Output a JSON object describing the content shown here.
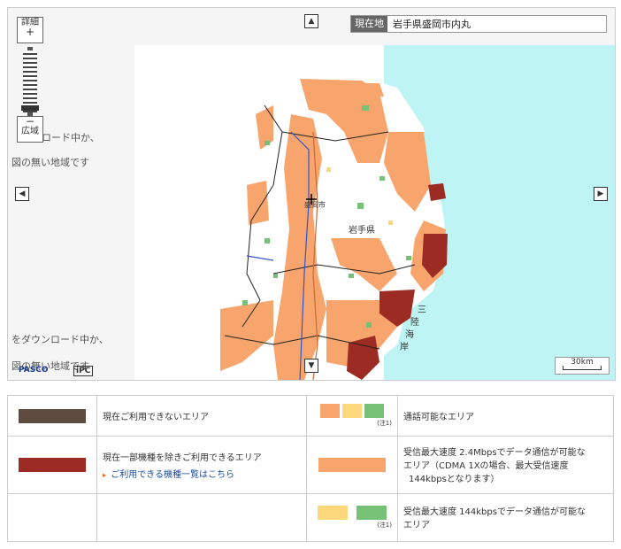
{
  "map": {
    "location_label": "現在地",
    "location_value": "岩手県盛岡市内丸",
    "zoom_in_label": "詳細",
    "zoom_out_label": "広域",
    "plus": "+",
    "minus": "−",
    "nodata_line1": "ロード中か、",
    "nodata_line2": "図の無い地域です",
    "nodata_line3": "をダウンロード中か、",
    "nodata_line4": "図の無い地域です",
    "city_label": "盛岡市",
    "prefecture_label": "岩手県",
    "coast_label_chars": [
      "三",
      "陸",
      "海",
      "岸"
    ],
    "scale_label": "30km",
    "logo_pasco": "PASCO",
    "logo_ipc": "iPC",
    "pan_up_icon": "triangle-up",
    "pan_down_icon": "triangle-down",
    "pan_left_icon": "triangle-left",
    "pan_right_icon": "triangle-right",
    "colors": {
      "sea": "#bff4f4",
      "coverage_orange": "#f7a56c",
      "coverage_yellow": "#fdd77b",
      "coverage_green": "#77c177",
      "unavailable_brown": "#5f4b40",
      "partial_dark_red": "#9c2b24"
    }
  },
  "legend": {
    "row1_text": "現在ご利用できないエリア",
    "row2_text": "現在一部機種を除きご利用できるエリア",
    "row2_link": "ご利用できる機種一覧はこちら",
    "row1_right_text": "通話可能なエリア",
    "row2_right_text_1": "受信最大速度 2.4Mbpsでデータ通信が可能な",
    "row2_right_text_2": "エリア（CDMA 1Xの場合、最大受信速度",
    "row2_right_text_3": "144kbpsとなります）",
    "row3_right_text_1": "受信最大速度 144kbpsでデータ通信が可能な",
    "row3_right_text_2": "エリア",
    "note_1": "(注1)",
    "note_2": "(注1)"
  }
}
